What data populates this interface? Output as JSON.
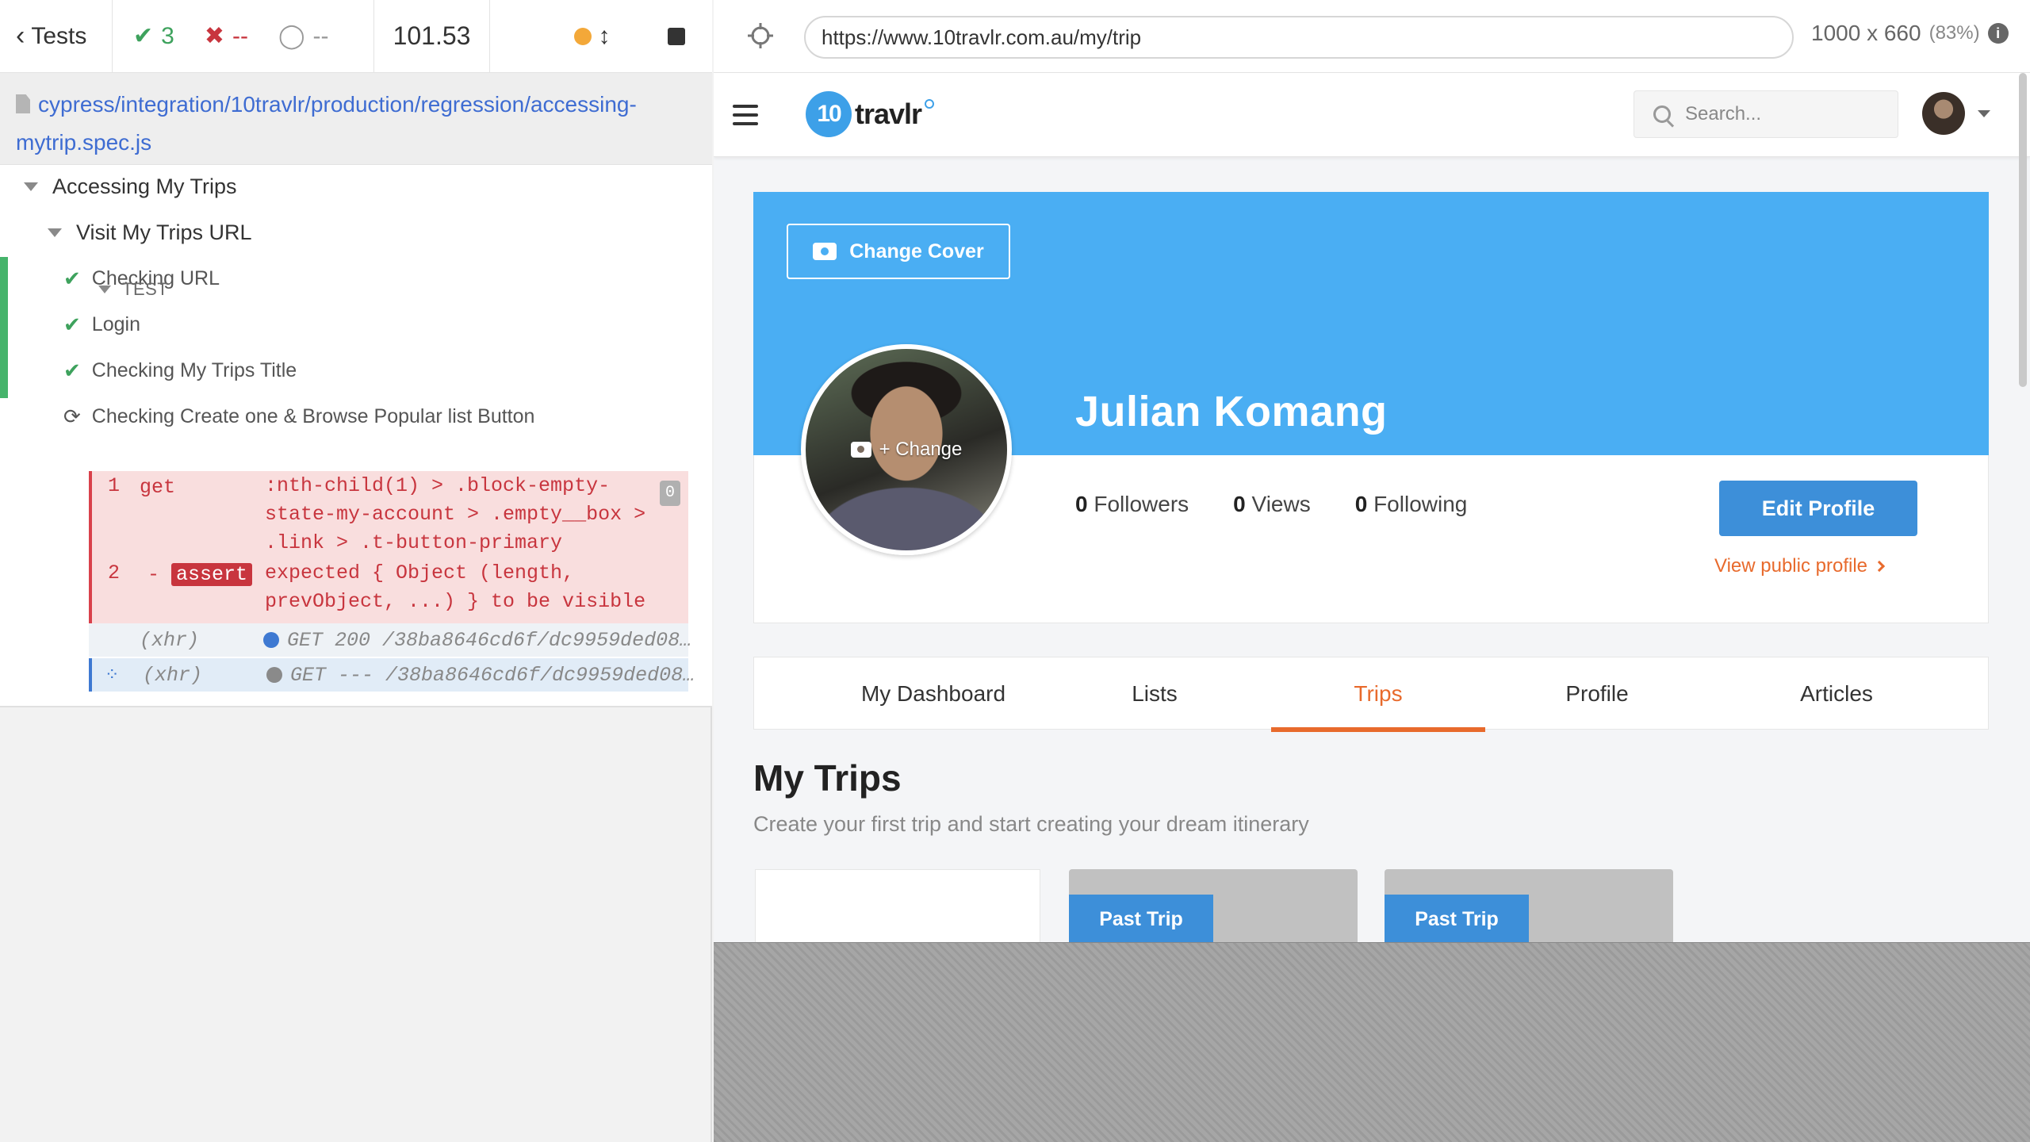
{
  "reporter": {
    "tests_label": "Tests",
    "stats": {
      "passed": "3",
      "failed": "--",
      "pending": "--"
    },
    "duration": "101.53",
    "spec_path_line1": "cypress/integration/10travlr/production/regression/accessing-",
    "spec_path_line2": "mytrip.spec.js",
    "suite_title": "Accessing My Trips",
    "sub_suite_title": "Visit My Trips URL",
    "tests": [
      {
        "title": "Checking URL",
        "state": "passed"
      },
      {
        "title": "Login",
        "state": "passed"
      },
      {
        "title": "Checking My Trips Title",
        "state": "passed"
      },
      {
        "title": "Checking Create one & Browse Popular list Button",
        "state": "running"
      }
    ],
    "test_section_label": "TEST",
    "commands": [
      {
        "num": "1",
        "name": "get",
        "message_lines": [
          ":nth-child(1) > .block-empty-",
          "state-my-account > .empty__box >",
          ".link > .t-button-primary"
        ],
        "badge": "0"
      },
      {
        "num": "2",
        "name_prefix": "-",
        "name": "assert",
        "message_lines": [
          "expected { Object (length,",
          "prevObject, ...) } to be visible"
        ]
      }
    ],
    "xhr": [
      {
        "label": "(xhr)",
        "message": "GET 200 /38ba8646cd6f/dc9959ded08…",
        "dot_color": "#3e79d2"
      },
      {
        "label": "(xhr)",
        "message": "GET --- /38ba8646cd6f/dc9959ded08…",
        "dot_color": "#8a8a8a"
      }
    ]
  },
  "aut": {
    "url": "https://www.10travlr.com.au/my/trip",
    "viewport": "1000 x 660",
    "scale": "(83%)",
    "app": {
      "logo_badge": "10",
      "logo_text": "travlr",
      "search_placeholder": "Search...",
      "change_cover": "Change Cover",
      "avatar_change": "+ Change",
      "name": "Julian Komang",
      "stats": [
        {
          "count": "0",
          "label": "Followers"
        },
        {
          "count": "0",
          "label": "Views"
        },
        {
          "count": "0",
          "label": "Following"
        }
      ],
      "edit_profile": "Edit Profile",
      "view_public": "View public profile",
      "tabs": [
        "My Dashboard",
        "Lists",
        "Trips",
        "Profile",
        "Articles"
      ],
      "active_tab": "Trips",
      "section_title": "My Trips",
      "section_subtitle": "Create your first trip and start creating your dream itinerary",
      "trip_badges": [
        "Past Trip",
        "Past Trip"
      ]
    }
  },
  "colors": {
    "cover_blue": "#4aaef3",
    "primary_button": "#3d8fd9",
    "accent_orange": "#e86a2c",
    "pass_green": "#3ea25d",
    "fail_red": "#c8353e"
  }
}
